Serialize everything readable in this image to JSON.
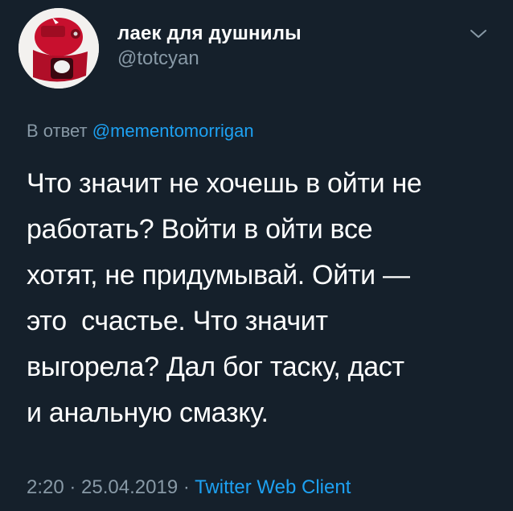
{
  "author": {
    "display_name": "лаек для душнилы",
    "handle": "@totcyan"
  },
  "icons": {
    "menu": "chevron-down-icon"
  },
  "reply": {
    "prefix": "В ответ",
    "mention": "@mementomorrigan"
  },
  "tweet": {
    "lines": [
      "Что значит не хочешь в ойти не",
      "работать? Войти в ойти все",
      "хотят, не придумывай. Ойти —",
      "это  счастье. Что значит",
      "выгорела? Дал бог таску, даст",
      "и анальную смазку."
    ]
  },
  "meta": {
    "time": "2:20",
    "separator": " · ",
    "date": "25.04.2019",
    "client": "Twitter Web Client"
  },
  "colors": {
    "background": "#15202b",
    "text_primary": "#ffffff",
    "text_secondary": "#8899a6",
    "link": "#1da1f2"
  }
}
